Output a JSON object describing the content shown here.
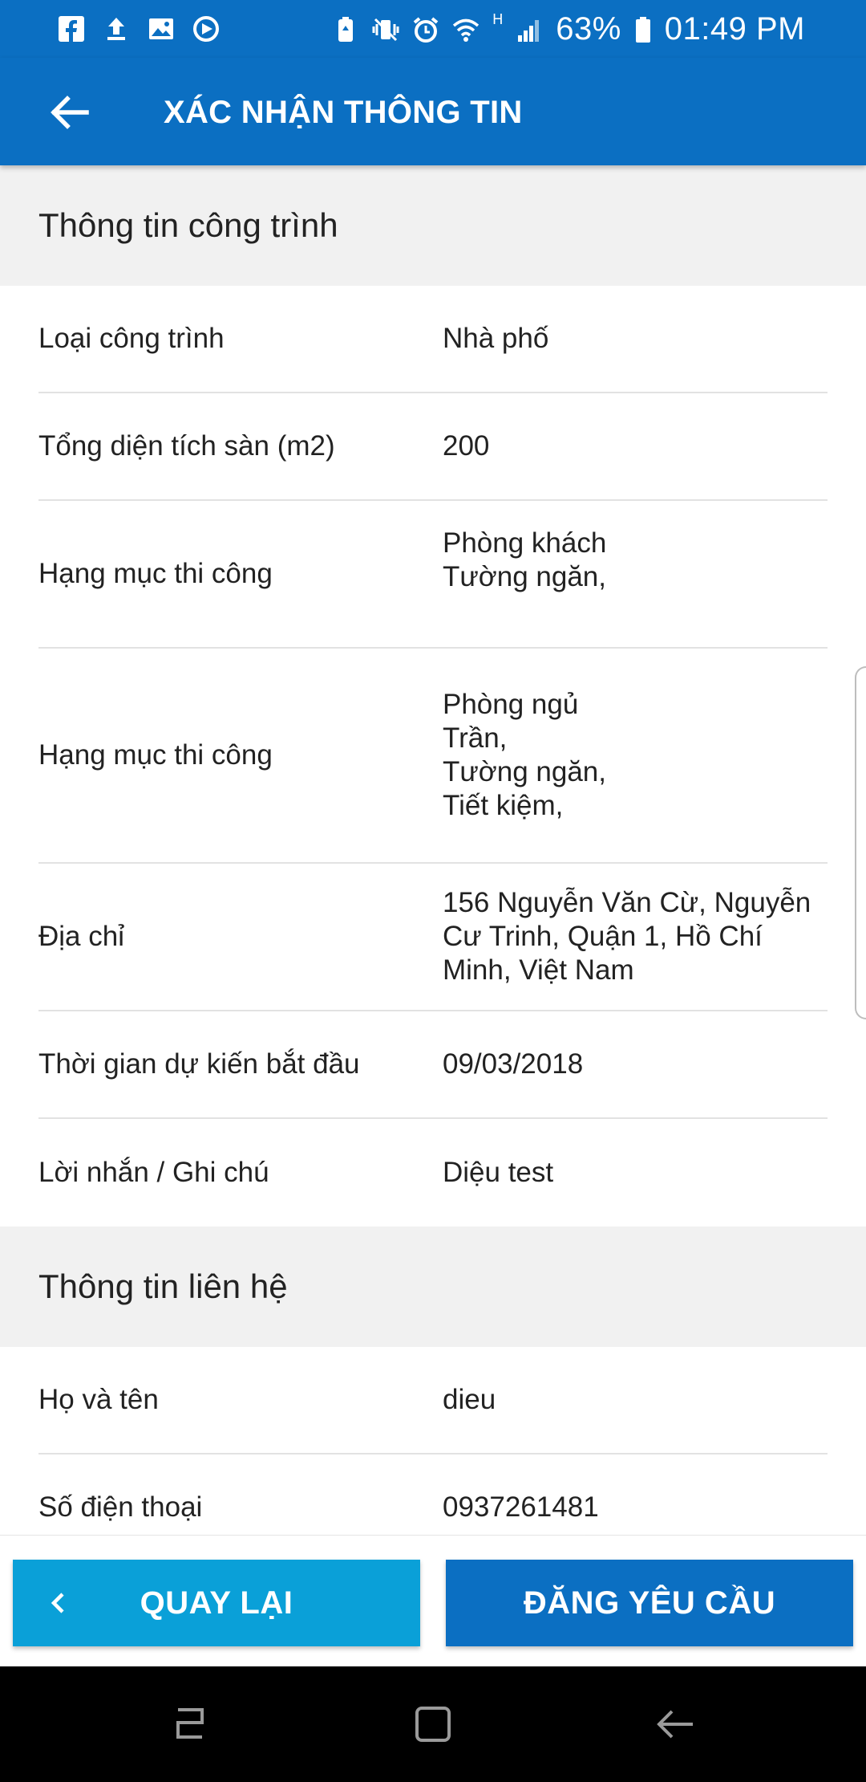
{
  "status_bar": {
    "battery_percent": "63%",
    "time": "01:49 PM",
    "network_type": "H",
    "left_icons": [
      "facebook-icon",
      "upload-icon",
      "image-icon",
      "sync-icon"
    ],
    "right_icons": [
      "battery-saver-icon",
      "vibrate-icon",
      "alarm-icon",
      "wifi-icon",
      "signal-icon",
      "battery-icon"
    ]
  },
  "app_bar": {
    "title": "XÁC NHẬN THÔNG TIN",
    "back_icon": "arrow-left-icon"
  },
  "sections": {
    "project": {
      "title": "Thông tin công trình",
      "rows": [
        {
          "label": "Loại công trình",
          "value": "Nhà phố"
        },
        {
          "label": "Tổng diện tích sàn (m2)",
          "value": "200"
        },
        {
          "label": "Hạng mục thi công",
          "value": "Phòng khách\nTường ngăn,"
        },
        {
          "label": "Hạng mục thi công",
          "value": "Phòng ngủ\nTrần,\nTường ngăn,\nTiết kiệm,"
        },
        {
          "label": "Địa chỉ",
          "value": "156 Nguyễn Văn Cừ, Nguyễn\nCư Trinh, Quận 1, Hồ Chí\nMinh, Việt Nam"
        },
        {
          "label": "Thời gian dự kiến bắt đầu",
          "value": "09/03/2018"
        },
        {
          "label": "Lời nhắn / Ghi chú",
          "value": "Diệu test"
        }
      ]
    },
    "contact": {
      "title": "Thông tin liên hệ",
      "rows": [
        {
          "label": "Họ và tên",
          "value": "dieu"
        },
        {
          "label": "Số điện thoại",
          "value": "0937261481"
        }
      ]
    }
  },
  "buttons": {
    "back_label": "QUAY LẠI",
    "submit_label": "ĐĂNG YÊU CẦU"
  },
  "colors": {
    "primary": "#0b6fc2",
    "secondary": "#0aa0d8",
    "section_bg": "#f1f1f1",
    "divider": "#e2e2e2"
  }
}
